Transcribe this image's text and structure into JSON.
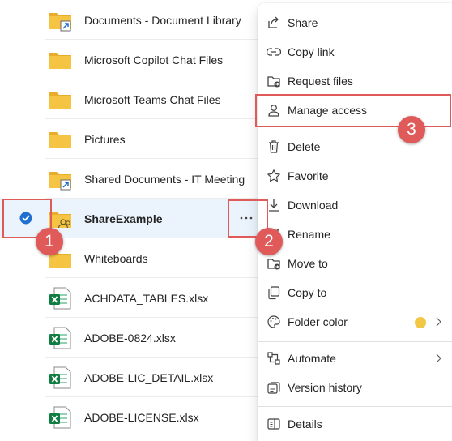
{
  "files": [
    {
      "name": "Documents - Document Library",
      "icon": "folder-shortcut-icon"
    },
    {
      "name": "Microsoft Copilot Chat Files",
      "icon": "folder-icon"
    },
    {
      "name": "Microsoft Teams Chat Files",
      "icon": "folder-icon"
    },
    {
      "name": "Pictures",
      "icon": "folder-icon"
    },
    {
      "name": "Shared Documents - IT Meeting",
      "icon": "folder-shortcut-icon"
    },
    {
      "name": "ShareExample",
      "icon": "shared-folder-icon",
      "selected": true
    },
    {
      "name": "Whiteboards",
      "icon": "folder-icon"
    },
    {
      "name": "ACHDATA_TABLES.xlsx",
      "icon": "excel-file-icon"
    },
    {
      "name": "ADOBE-0824.xlsx",
      "icon": "excel-file-icon"
    },
    {
      "name": "ADOBE-LIC_DETAIL.xlsx",
      "icon": "excel-file-icon"
    },
    {
      "name": "ADOBE-LICENSE.xlsx",
      "icon": "excel-file-icon"
    }
  ],
  "more_button_glyph": "···",
  "context_menu": {
    "items": [
      {
        "label": "Share",
        "icon": "share-icon"
      },
      {
        "label": "Copy link",
        "icon": "link-icon"
      },
      {
        "label": "Request files",
        "icon": "request-files-icon"
      },
      {
        "label": "Manage access",
        "icon": "person-icon"
      },
      {
        "label": "Delete",
        "icon": "trash-icon"
      },
      {
        "label": "Favorite",
        "icon": "star-icon"
      },
      {
        "label": "Download",
        "icon": "download-icon"
      },
      {
        "label": "Rename",
        "icon": "rename-icon"
      },
      {
        "label": "Move to",
        "icon": "move-to-icon"
      },
      {
        "label": "Copy to",
        "icon": "copy-icon"
      },
      {
        "label": "Folder color",
        "icon": "palette-icon",
        "swatch": "#f2c744",
        "has_submenu": true
      },
      {
        "label": "Automate",
        "icon": "automate-icon",
        "has_submenu": true
      },
      {
        "label": "Version history",
        "icon": "version-history-icon"
      },
      {
        "label": "Details",
        "icon": "details-icon"
      }
    ]
  },
  "annotations": {
    "badges": [
      "1",
      "2",
      "3"
    ],
    "color": "#e05a5a"
  },
  "colors": {
    "folder": "#f6c443",
    "folder_tab": "#e8ad2a",
    "selection": "#ebf3fc",
    "check": "#1f6fd1",
    "excel": "#107c41"
  }
}
